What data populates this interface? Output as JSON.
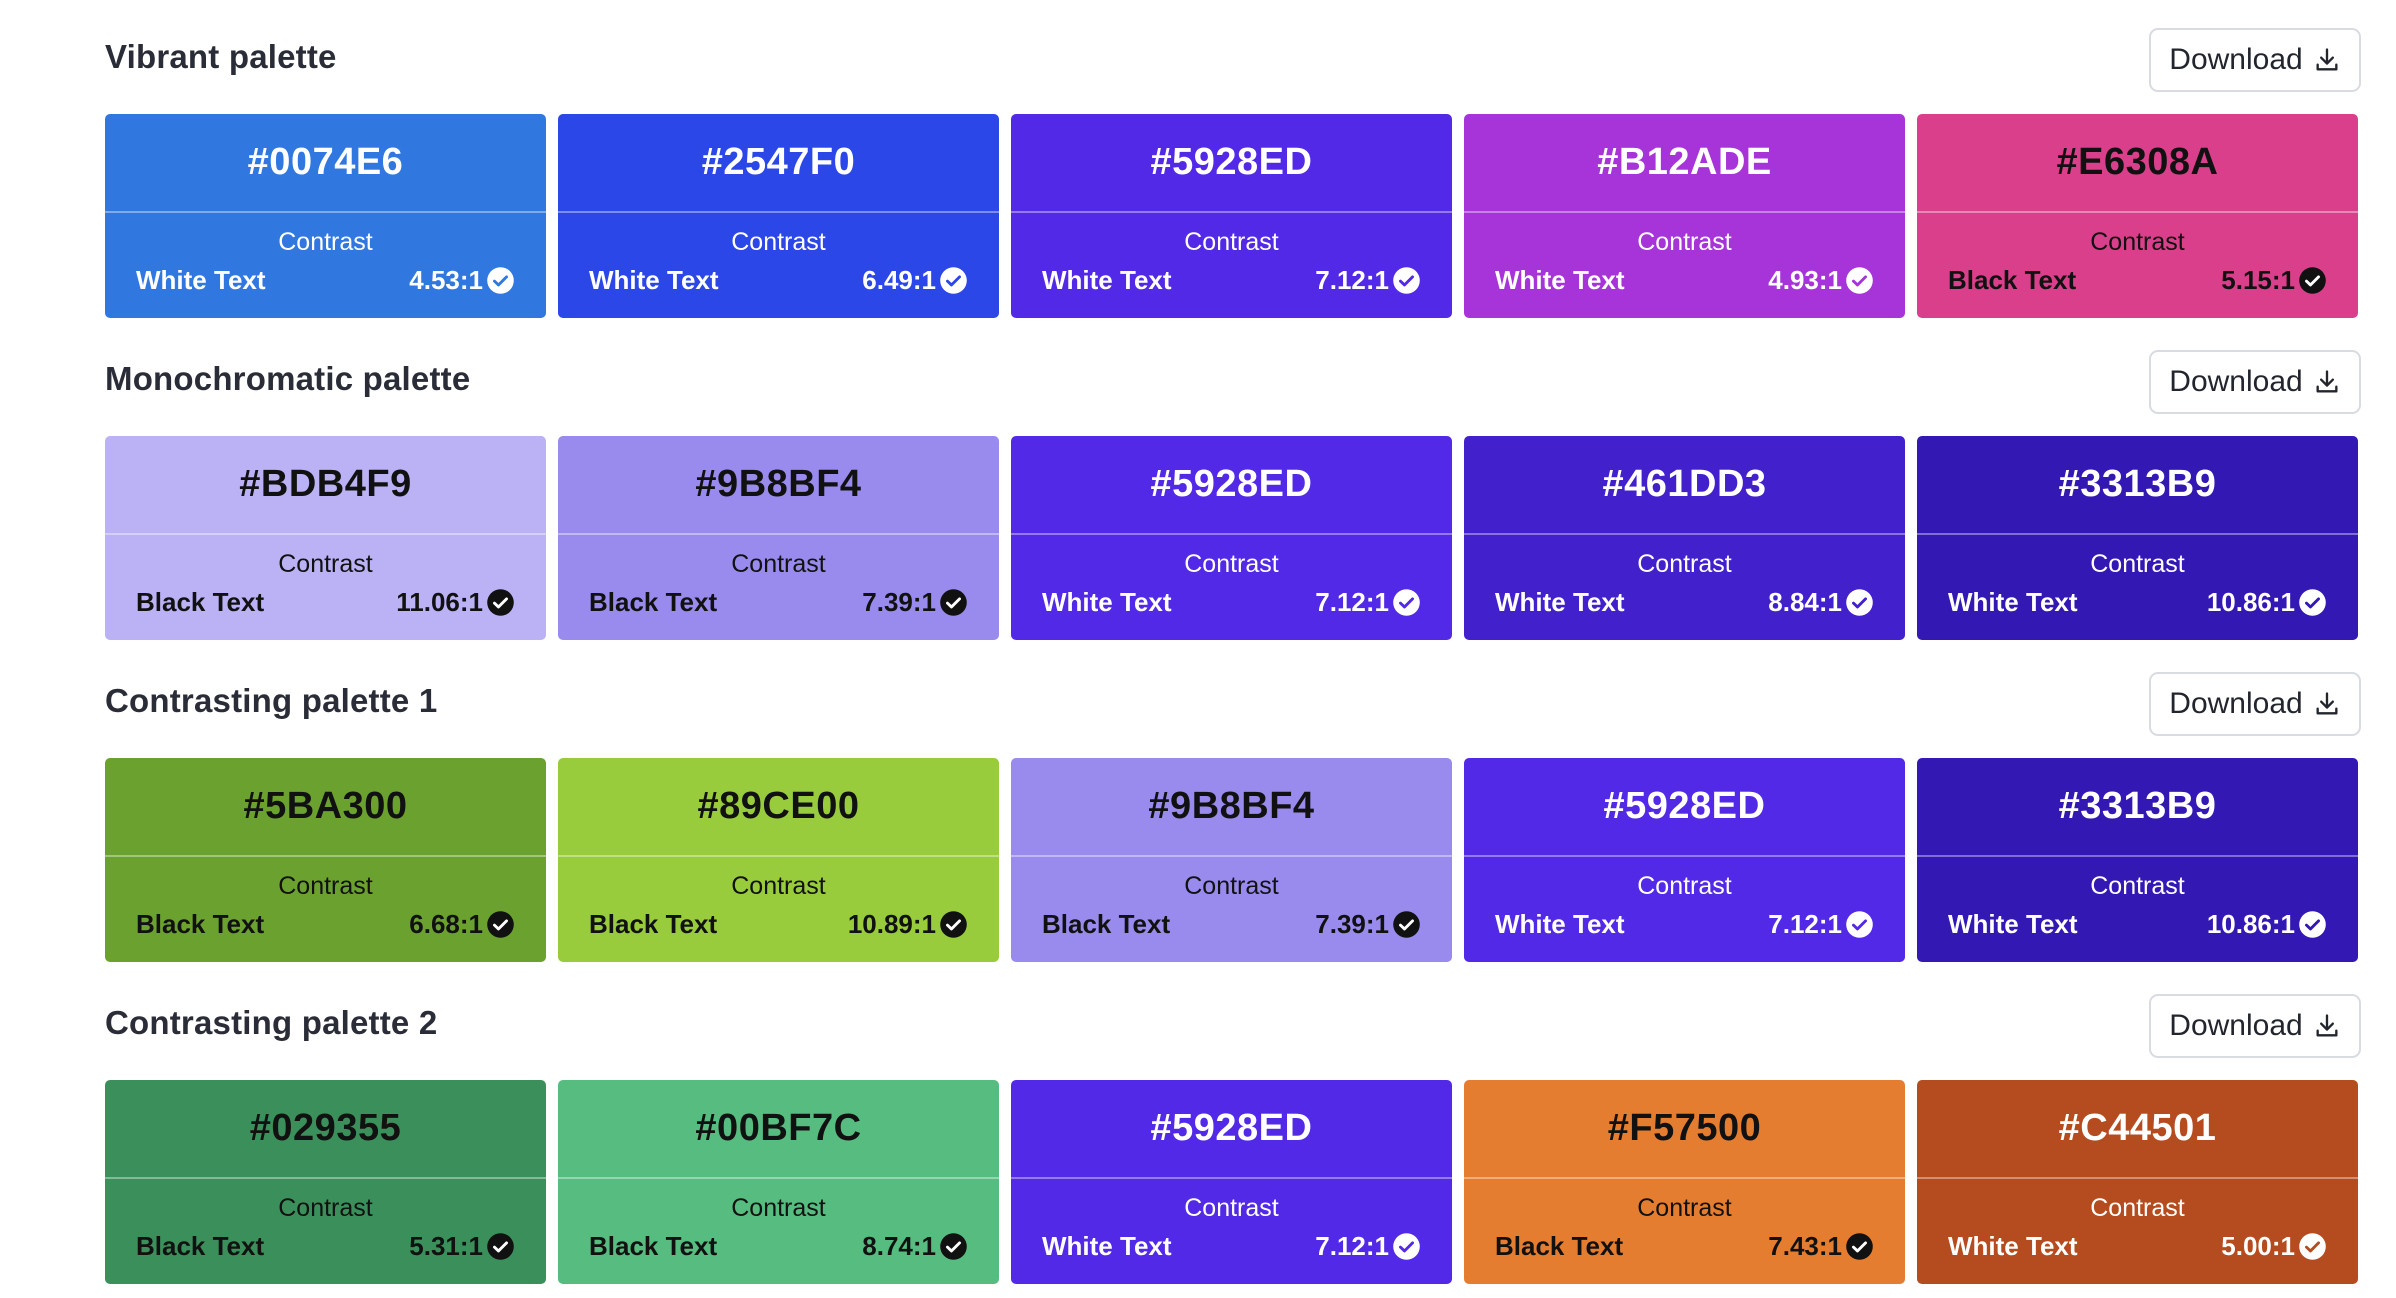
{
  "download_label": "Download",
  "contrast_label": "Contrast",
  "palettes": [
    {
      "title": "Vibrant palette",
      "colors": [
        {
          "hex": "#0074E6",
          "bg": "#3078e0",
          "text_mode": "White Text",
          "ratio": "4.53:1",
          "fg": "light"
        },
        {
          "hex": "#2547F0",
          "bg": "#2b47e8",
          "text_mode": "White Text",
          "ratio": "6.49:1",
          "fg": "light"
        },
        {
          "hex": "#5928ED",
          "bg": "#5229e6",
          "text_mode": "White Text",
          "ratio": "7.12:1",
          "fg": "light"
        },
        {
          "hex": "#B12ADE",
          "bg": "#a634d8",
          "text_mode": "White Text",
          "ratio": "4.93:1",
          "fg": "light"
        },
        {
          "hex": "#E6308A",
          "bg": "#d93f8a",
          "text_mode": "Black Text",
          "ratio": "5.15:1",
          "fg": "dark"
        }
      ]
    },
    {
      "title": "Monochromatic palette",
      "colors": [
        {
          "hex": "#BDB4F9",
          "bg": "#bab2f5",
          "text_mode": "Black Text",
          "ratio": "11.06:1",
          "fg": "dark"
        },
        {
          "hex": "#9B8BF4",
          "bg": "#998bed",
          "text_mode": "Black Text",
          "ratio": "7.39:1",
          "fg": "dark"
        },
        {
          "hex": "#5928ED",
          "bg": "#5229e6",
          "text_mode": "White Text",
          "ratio": "7.12:1",
          "fg": "light"
        },
        {
          "hex": "#461DD3",
          "bg": "#4220cc",
          "text_mode": "White Text",
          "ratio": "8.84:1",
          "fg": "light"
        },
        {
          "hex": "#3313B9",
          "bg": "#3318b3",
          "text_mode": "White Text",
          "ratio": "10.86:1",
          "fg": "light"
        }
      ]
    },
    {
      "title": "Contrasting palette 1",
      "colors": [
        {
          "hex": "#5BA300",
          "bg": "#6ba12e",
          "text_mode": "Black Text",
          "ratio": "6.68:1",
          "fg": "dark"
        },
        {
          "hex": "#89CE00",
          "bg": "#98cc3c",
          "text_mode": "Black Text",
          "ratio": "10.89:1",
          "fg": "dark"
        },
        {
          "hex": "#9B8BF4",
          "bg": "#998bed",
          "text_mode": "Black Text",
          "ratio": "7.39:1",
          "fg": "dark"
        },
        {
          "hex": "#5928ED",
          "bg": "#5229e6",
          "text_mode": "White Text",
          "ratio": "7.12:1",
          "fg": "light"
        },
        {
          "hex": "#3313B9",
          "bg": "#3318b3",
          "text_mode": "White Text",
          "ratio": "10.86:1",
          "fg": "light"
        }
      ]
    },
    {
      "title": "Contrasting palette 2",
      "colors": [
        {
          "hex": "#029355",
          "bg": "#3b8f5a",
          "text_mode": "Black Text",
          "ratio": "5.31:1",
          "fg": "dark"
        },
        {
          "hex": "#00BF7C",
          "bg": "#56bc80",
          "text_mode": "Black Text",
          "ratio": "8.74:1",
          "fg": "dark"
        },
        {
          "hex": "#5928ED",
          "bg": "#5229e6",
          "text_mode": "White Text",
          "ratio": "7.12:1",
          "fg": "light"
        },
        {
          "hex": "#F57500",
          "bg": "#e57d31",
          "text_mode": "Black Text",
          "ratio": "7.43:1",
          "fg": "dark"
        },
        {
          "hex": "#C44501",
          "bg": "#b44c1f",
          "text_mode": "White Text",
          "ratio": "5.00:1",
          "fg": "light"
        }
      ]
    }
  ]
}
